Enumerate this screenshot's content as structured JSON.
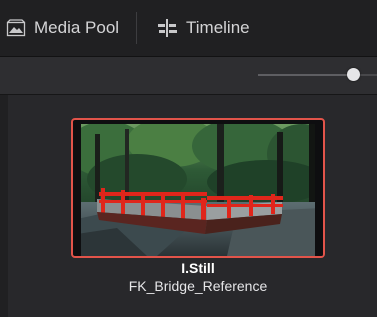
{
  "tabs": [
    {
      "label": "Media Pool",
      "icon": "media-pool-icon"
    },
    {
      "label": "Timeline",
      "icon": "timeline-icon"
    }
  ],
  "toolbar": {
    "zoom_level": 0.8
  },
  "bin": {
    "clips": [
      {
        "name": "I.Still",
        "subtitle": "FK_Bridge_Reference",
        "thumbnail": "red-bridge-forest-thumbnail",
        "selected": true
      }
    ]
  },
  "colors": {
    "selection_border": "#e2544a",
    "bridge": "#e0261b",
    "panel": "#28282b"
  }
}
